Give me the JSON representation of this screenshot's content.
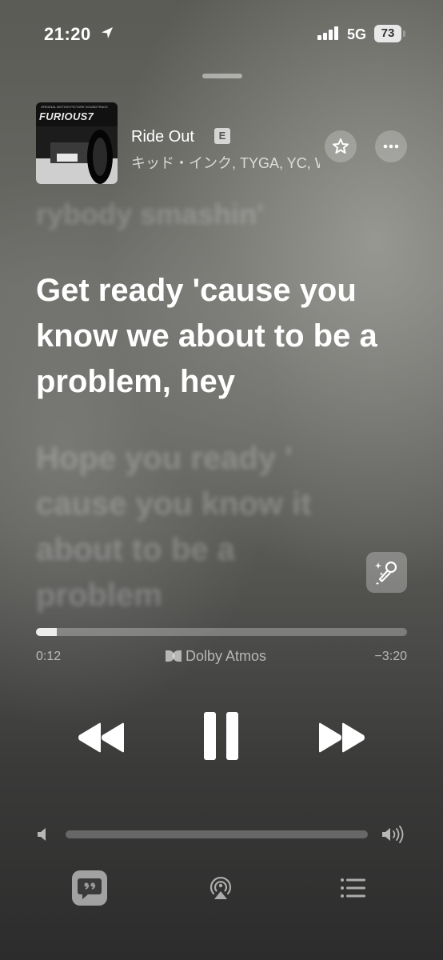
{
  "status_bar": {
    "time": "21:20",
    "network": "5G",
    "battery": "73"
  },
  "now_playing": {
    "artwork_title": "FURIOUS7",
    "artwork_subtitle": "ORIGINAL MOTION PICTURE SOUNDTRACK",
    "song_title": "Ride Out",
    "explicit_badge": "E",
    "artist": "キッド・インク, TYGA, YC, WALE, RICH HOMIE QUAN"
  },
  "lyrics": {
    "previous": "rybody smashin'",
    "current": "Get ready 'cause you know we about to be a problem, hey",
    "next": "Hope you ready ' cause you know it about to be a problem"
  },
  "playback": {
    "elapsed": "0:12",
    "remaining": "−3:20",
    "audio_format": "Dolby Atmos",
    "progress_fraction": 0.057,
    "volume_fraction": 0.0
  },
  "icons": {
    "location": "location-arrow-icon",
    "signal": "cellular-signal-icon",
    "favorite": "star-icon",
    "more": "ellipsis-icon",
    "sing": "microphone-sparkle-icon",
    "rewind": "rewind-icon",
    "pause": "pause-icon",
    "forward": "fast-forward-icon",
    "lyrics": "quote-bubble-icon",
    "airplay": "airplay-icon",
    "queue": "list-icon"
  }
}
